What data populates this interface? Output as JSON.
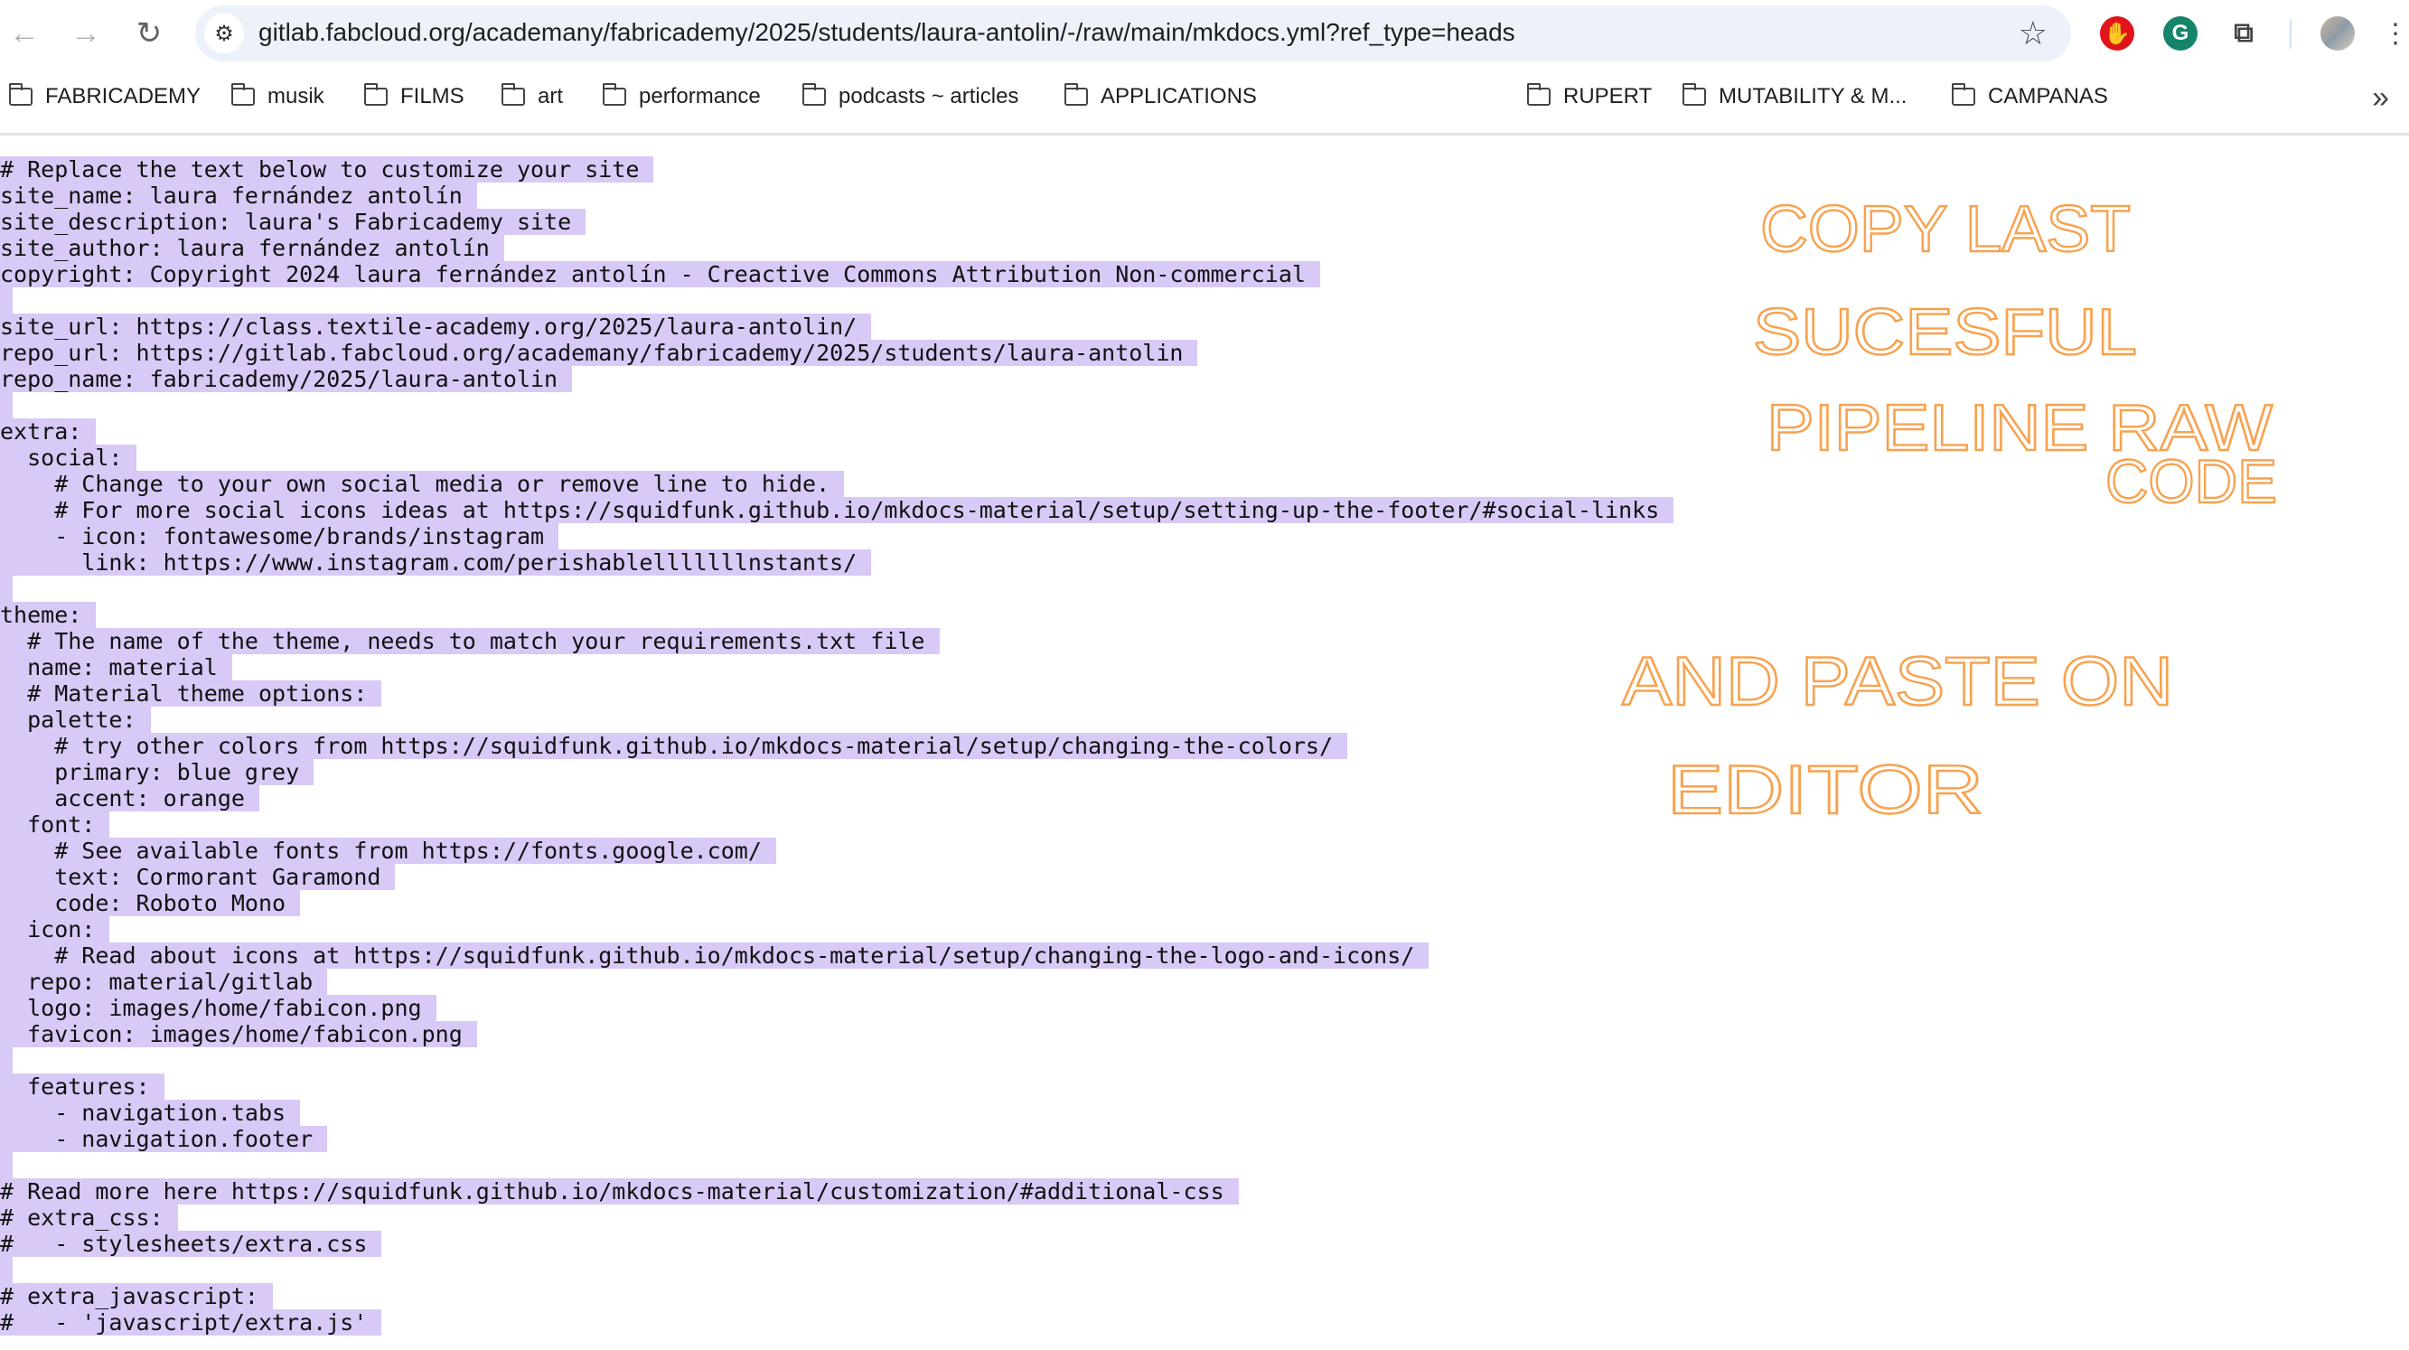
{
  "browser": {
    "url": "gitlab.fabcloud.org/academany/fabricademy/2025/students/laura-antolin/-/raw/main/mkdocs.yml?ref_type=heads",
    "icons": [
      "back-icon",
      "forward-icon",
      "reload-icon",
      "site-settings-icon",
      "bookmark-star-icon",
      "adblock-extension-icon",
      "grammarly-extension-icon",
      "extensions-puzzle-icon",
      "profile-avatar",
      "menu-kebab-icon"
    ],
    "bookmarks": [
      "FABRICADEMY",
      "musik",
      "FILMS",
      "art",
      "performance",
      "podcasts ~ articles",
      "APPLICATIONS",
      "RUPERT",
      "MUTABILITY & M...",
      "CAMPANAS"
    ],
    "overflow_label": "»"
  },
  "code_lines": [
    "# Replace the text below to customize your site",
    "site_name: laura fernández antolín",
    "site_description: laura's Fabricademy site",
    "site_author: laura fernández antolín",
    "copyright: Copyright 2024 laura fernández antolín - Creactive Commons Attribution Non-commercial",
    "",
    "site_url: https://class.textile-academy.org/2025/laura-antolin/",
    "repo_url: https://gitlab.fabcloud.org/academany/fabricademy/2025/students/laura-antolin",
    "repo_name: fabricademy/2025/laura-antolin",
    "",
    "extra:",
    "  social:",
    "    # Change to your own social media or remove line to hide.",
    "    # For more social icons ideas at https://squidfunk.github.io/mkdocs-material/setup/setting-up-the-footer/#social-links",
    "    - icon: fontawesome/brands/instagram",
    "      link: https://www.instagram.com/perishablelllllllnstants/",
    "",
    "theme:",
    "  # The name of the theme, needs to match your requirements.txt file",
    "  name: material",
    "  # Material theme options:",
    "  palette:",
    "    # try other colors from https://squidfunk.github.io/mkdocs-material/setup/changing-the-colors/",
    "    primary: blue grey",
    "    accent: orange",
    "  font:",
    "    # See available fonts from https://fonts.google.com/",
    "    text: Cormorant Garamond",
    "    code: Roboto Mono",
    "  icon:",
    "    # Read about icons at https://squidfunk.github.io/mkdocs-material/setup/changing-the-logo-and-icons/",
    "  repo: material/gitlab",
    "  logo: images/home/fabicon.png",
    "  favicon: images/home/fabicon.png",
    "",
    "  features:",
    "    - navigation.tabs",
    "    - navigation.footer",
    "",
    "# Read more here https://squidfunk.github.io/mkdocs-material/customization/#additional-css",
    "# extra_css:",
    "#   - stylesheets/extra.css",
    "",
    "# extra_javascript:",
    "#   - 'javascript/extra.js'"
  ],
  "annotations": {
    "note1": [
      "COPY LAST",
      "SUCESFUL",
      "PIPELINE RAW",
      "CODE"
    ],
    "note2": [
      "AND PASTE ON",
      "EDITOR"
    ],
    "color": "#f7a24f"
  },
  "colors": {
    "selection": "#d8c9f7",
    "omnibox": "#edf2fa"
  }
}
